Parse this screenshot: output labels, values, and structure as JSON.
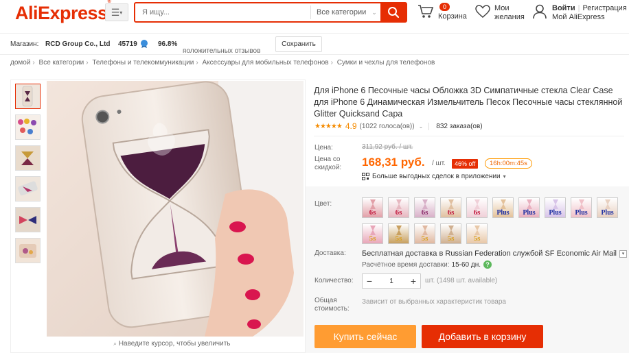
{
  "header": {
    "logo": "AliExpress",
    "logo_mark": "®",
    "search_placeholder": "Я ищу...",
    "search_category": "Все категории",
    "cart_count": "0",
    "cart_label": "Корзина",
    "wishlist_line1": "Мои",
    "wishlist_line2": "желания",
    "signin_label": "Войти",
    "register_label": "Регистрация",
    "my_aliexpress": "Мой AliExpress"
  },
  "store": {
    "label": "Магазин:",
    "name": "RCD Group Co., Ltd",
    "score": "45719",
    "positive_pct": "96.8%",
    "positive_label": "положительных отзывов",
    "save_label": "Сохранить"
  },
  "breadcrumb": [
    "домой",
    "Все категории",
    "Телефоны и телекоммуникации",
    "Аксессуары для мобильных телефонов",
    "Сумки и чехлы для телефонов"
  ],
  "gallery": {
    "zoom_hint": "Наведите курсор, чтобы увеличить"
  },
  "product": {
    "title": "Для iPhone 6 Песочные часы Обложка 3D Симпатичные стекла Clear Case для iPhone 6 Динамическая Измельчитель Песок Песочные часы стеклянной Glitter Quicksand Capa",
    "stars": "★★★★★",
    "rating": "4.9",
    "votes": "(1022 голоса(ов))",
    "orders": "832 заказа(ов)",
    "price_label": "Цена:",
    "old_price": "311,92 руб. / шт.",
    "discount_price_label_1": "Цена со",
    "discount_price_label_2": "скидкой:",
    "new_price": "168,31 руб.",
    "per_unit": "/ шт.",
    "discount": "46% off",
    "timer": "16h:00m:45s",
    "app_deals": "Больше выгодных сделок в приложении",
    "color_label": "Цвет:",
    "color_tags": [
      "6s",
      "6s",
      "6s",
      "6s",
      "6s",
      "Plus",
      "Plus",
      "Plus",
      "Plus",
      "Plus",
      "5s",
      "5s",
      "5s",
      "5s",
      "5s"
    ],
    "shipping_label": "Доставка:",
    "shipping_text": "Бесплатная доставка в Russian Federation службой SF Economic Air Mail",
    "delivery_label": "Расчётное время доставки:",
    "delivery_time": "15-60 дн.",
    "quantity_label": "Количество:",
    "quantity": "1",
    "quantity_info": "шт. (1498 шт. available)",
    "total_label_1": "Общая",
    "total_label_2": "стоимость:",
    "total_info": "Зависит от выбранных характеристик товара",
    "buy_now": "Купить сейчас",
    "add_to_cart": "Добавить в корзину"
  },
  "colors": {
    "brand": "#e62e04",
    "price": "#ff6600",
    "star": "#f58b00",
    "buy_button": "#ff9c32"
  }
}
